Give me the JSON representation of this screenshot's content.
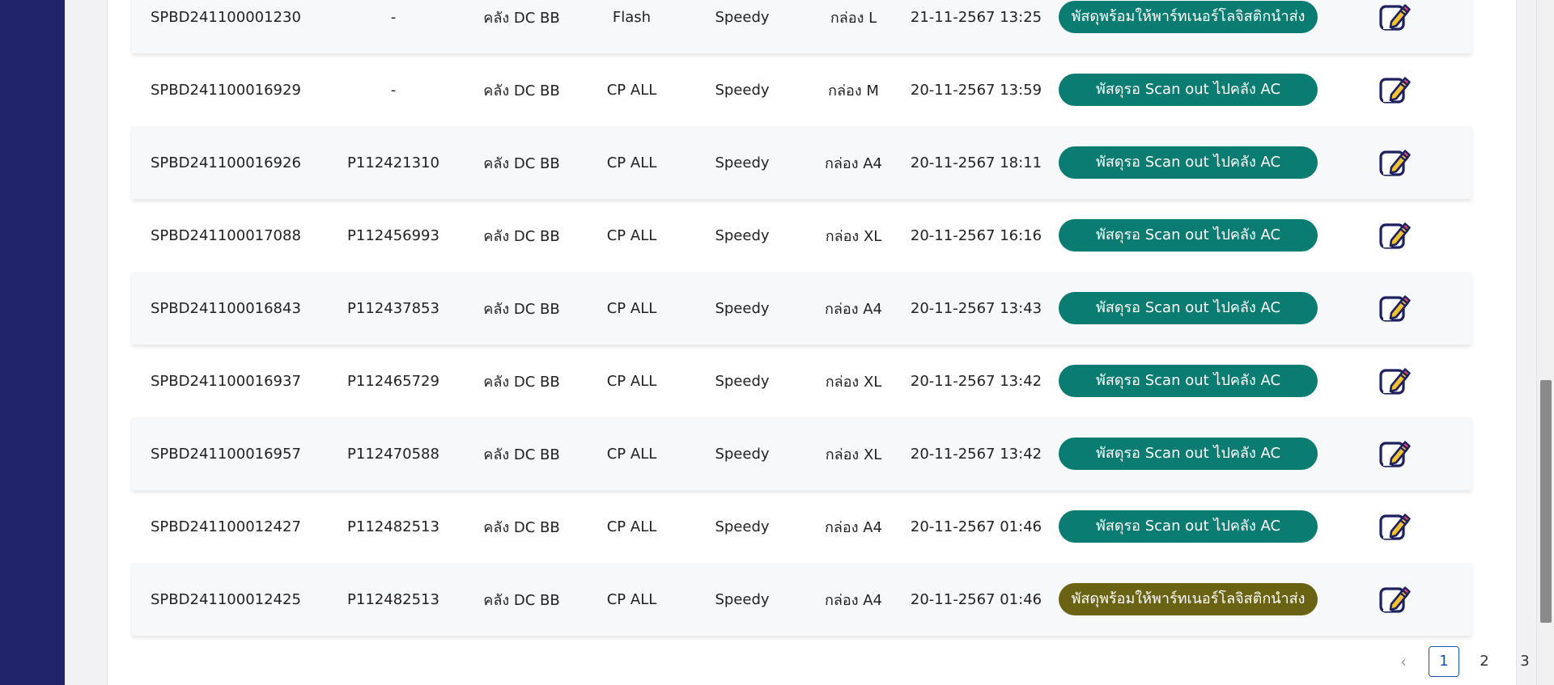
{
  "rows": [
    {
      "id": "SPBD241100001230",
      "po": "-",
      "warehouse": "คลัง DC BB",
      "carrier": "Flash",
      "speed": "Speedy",
      "box": "กล่อง L",
      "datetime": "21-11-2567 13:25",
      "status": "พัสดุพร้อมให้พาร์ทเนอร์โลจิสติกนำส่ง",
      "status_color": "#0b7c71"
    },
    {
      "id": "SPBD241100016929",
      "po": "-",
      "warehouse": "คลัง DC BB",
      "carrier": "CP ALL",
      "speed": "Speedy",
      "box": "กล่อง M",
      "datetime": "20-11-2567 13:59",
      "status": "พัสดุรอ Scan out ไปคลัง AC",
      "status_color": "#0b7c71"
    },
    {
      "id": "SPBD241100016926",
      "po": "P112421310",
      "warehouse": "คลัง DC BB",
      "carrier": "CP ALL",
      "speed": "Speedy",
      "box": "กล่อง A4",
      "datetime": "20-11-2567 18:11",
      "status": "พัสดุรอ Scan out ไปคลัง AC",
      "status_color": "#0b7c71"
    },
    {
      "id": "SPBD241100017088",
      "po": "P112456993",
      "warehouse": "คลัง DC BB",
      "carrier": "CP ALL",
      "speed": "Speedy",
      "box": "กล่อง XL",
      "datetime": "20-11-2567 16:16",
      "status": "พัสดุรอ Scan out ไปคลัง AC",
      "status_color": "#0b7c71"
    },
    {
      "id": "SPBD241100016843",
      "po": "P112437853",
      "warehouse": "คลัง DC BB",
      "carrier": "CP ALL",
      "speed": "Speedy",
      "box": "กล่อง A4",
      "datetime": "20-11-2567 13:43",
      "status": "พัสดุรอ Scan out ไปคลัง AC",
      "status_color": "#0b7c71"
    },
    {
      "id": "SPBD241100016937",
      "po": "P112465729",
      "warehouse": "คลัง DC BB",
      "carrier": "CP ALL",
      "speed": "Speedy",
      "box": "กล่อง XL",
      "datetime": "20-11-2567 13:42",
      "status": "พัสดุรอ Scan out ไปคลัง AC",
      "status_color": "#0b7c71"
    },
    {
      "id": "SPBD241100016957",
      "po": "P112470588",
      "warehouse": "คลัง DC BB",
      "carrier": "CP ALL",
      "speed": "Speedy",
      "box": "กล่อง XL",
      "datetime": "20-11-2567 13:42",
      "status": "พัสดุรอ Scan out ไปคลัง AC",
      "status_color": "#0b7c71"
    },
    {
      "id": "SPBD241100012427",
      "po": "P112482513",
      "warehouse": "คลัง DC BB",
      "carrier": "CP ALL",
      "speed": "Speedy",
      "box": "กล่อง A4",
      "datetime": "20-11-2567 01:46",
      "status": "พัสดุรอ Scan out ไปคลัง AC",
      "status_color": "#0b7c71"
    },
    {
      "id": "SPBD241100012425",
      "po": "P112482513",
      "warehouse": "คลัง DC BB",
      "carrier": "CP ALL",
      "speed": "Speedy",
      "box": "กล่อง A4",
      "datetime": "20-11-2567 01:46",
      "status": "พัสดุพร้อมให้พาร์ทเนอร์โลจิสติกนำส่ง",
      "status_color": "#6b6314"
    }
  ],
  "edit_icon": "edit-icon",
  "pagination": {
    "prev": "‹",
    "pages": [
      "1",
      "2",
      "3"
    ],
    "current": "1",
    "next": "›"
  },
  "colors": {
    "sidebar": "#22246b",
    "status_teal": "#0b7c71",
    "status_olive": "#6b6314",
    "edit_icon": "#1e2160",
    "active_page": "#1a56b0"
  }
}
